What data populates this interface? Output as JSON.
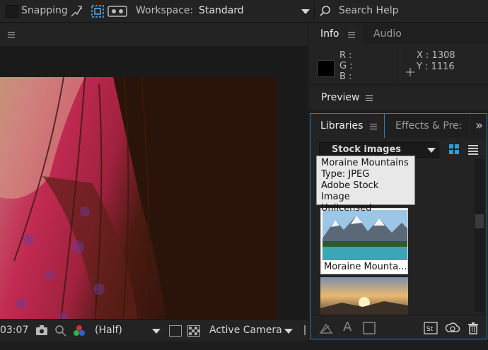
{
  "toolbar": {
    "snapping_label": "Snapping",
    "workspace_label": "Workspace:",
    "workspace_value": "Standard",
    "search_label": "Search Help"
  },
  "info_panel": {
    "tabs": [
      "Info",
      "Audio"
    ],
    "r_label": "R :",
    "g_label": "G :",
    "b_label": "B :",
    "x_readout": "X : 1308",
    "y_readout": "Y : 1116"
  },
  "preview_panel": {
    "title": "Preview"
  },
  "libraries_panel": {
    "tabs": [
      "Libraries",
      "Effects & Pre:"
    ],
    "overflow": "»",
    "dropdown_value": "Stock images",
    "tooltip": {
      "title": "Moraine Mountains",
      "type": "Type: JPEG",
      "source": "Adobe Stock Image",
      "license": "Unlicensed"
    },
    "items": [
      {
        "caption": "Moraine Mounta..."
      },
      {
        "caption": ""
      }
    ]
  },
  "comp_footer": {
    "timecode": "03:07",
    "resolution": "(Half)",
    "camera": "Active Camera"
  },
  "colors": {
    "accent_blue": "#2a7ec0",
    "grid_view_active": "#2d9de0"
  }
}
